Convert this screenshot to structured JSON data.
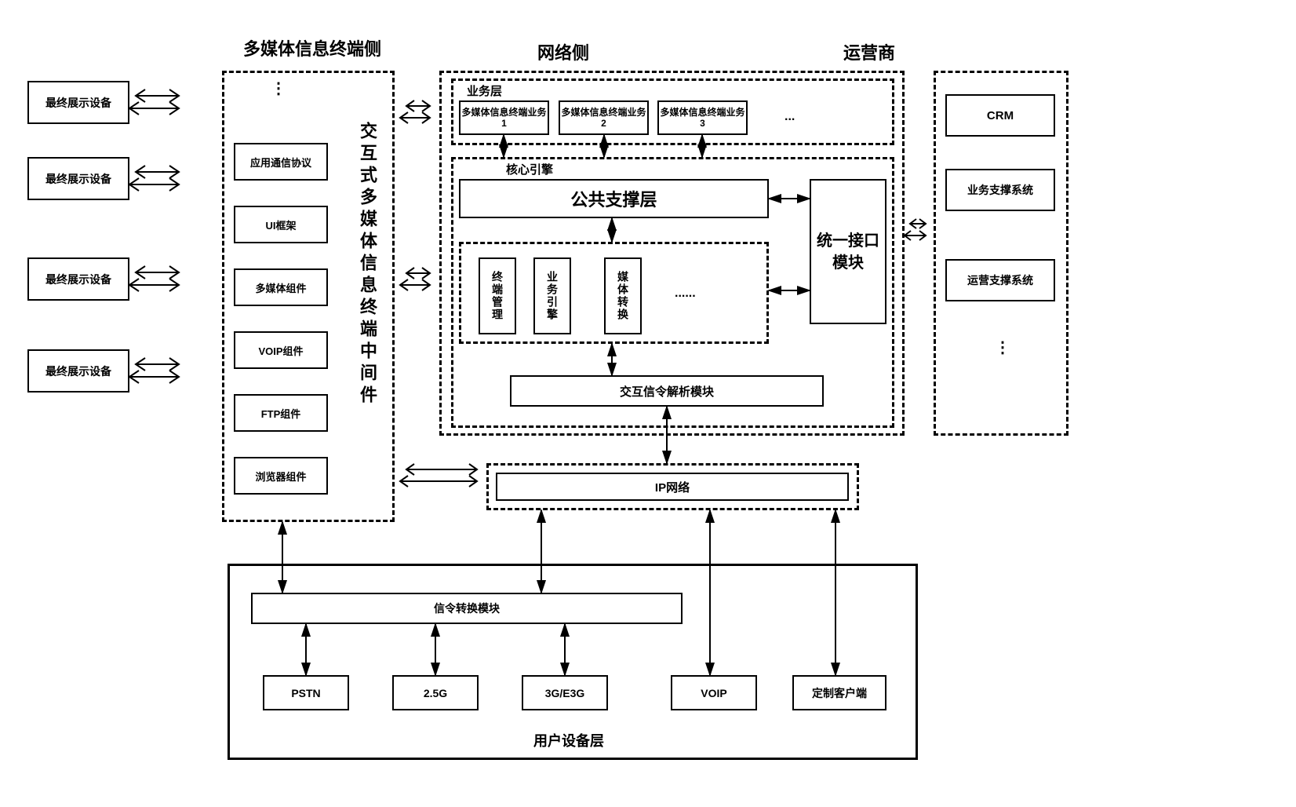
{
  "sections": {
    "terminal_side": "多媒体信息终端侧",
    "network_side": "网络侧",
    "operator_side": "运营商"
  },
  "display_devices": {
    "d1": "最终展示设备",
    "d2": "最终展示设备",
    "d3": "最终展示设备",
    "d4": "最终展示设备"
  },
  "terminal_components": {
    "c1": "应用通信协议",
    "c2": "UI框架",
    "c3": "多媒体组件",
    "c4": "VOIP组件",
    "c5": "FTP组件",
    "c6": "浏览器组件",
    "middleware": "交互式多媒体信息终端中间件"
  },
  "network": {
    "service_layer": "业务层",
    "service1": "多媒体信息终端业务1",
    "service2": "多媒体信息终端业务2",
    "service3": "多媒体信息终端业务3",
    "service_more": "...",
    "core_engine": "核心引擎",
    "public_support": "公共支撑层",
    "unified_interface": "统一接口模块",
    "terminal_mgmt": "终端管理",
    "service_engine": "业务引擎",
    "media_convert": "媒体转换",
    "more": "......",
    "signal_parse": "交互信令解析模块",
    "ip_network": "IP网络"
  },
  "operator": {
    "crm": "CRM",
    "biz_support": "业务支撑系统",
    "ops_support": "运营支撑系统"
  },
  "user_device": {
    "signal_convert": "信令转换模块",
    "pstn": "PSTN",
    "g25": "2.5G",
    "g3": "3G/E3G",
    "voip": "VOIP",
    "custom": "定制客户端",
    "layer": "用户设备层"
  }
}
